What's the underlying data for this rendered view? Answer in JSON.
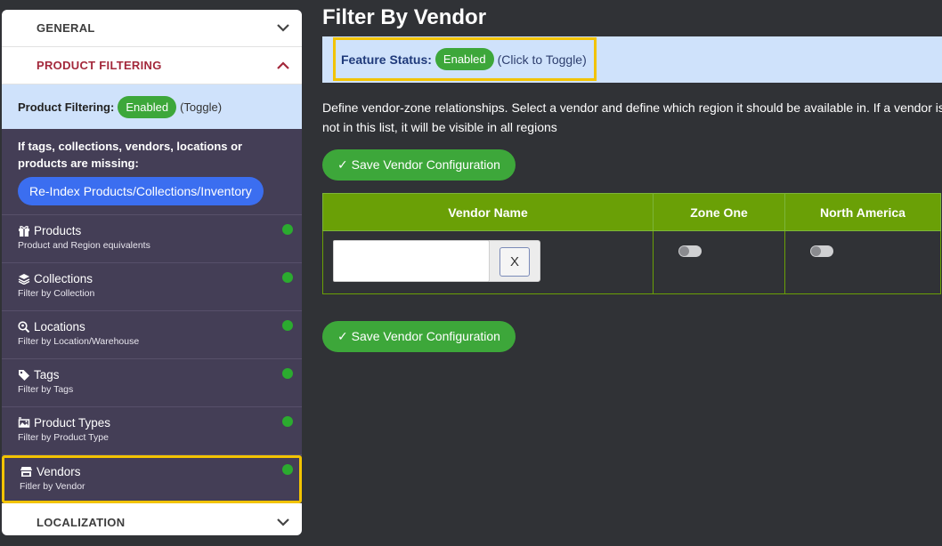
{
  "sidebar": {
    "general_label": "GENERAL",
    "product_filtering_label": "PRODUCT FILTERING",
    "pf_status_label": "Product Filtering:",
    "pf_status_badge": "Enabled",
    "pf_toggle": "(Toggle)",
    "reindex_note": "If tags, collections, vendors, locations or products are missing:",
    "reindex_button": "Re-Index Products/Collections/Inventory",
    "items": [
      {
        "title": "Products",
        "sub": "Product and Region equivalents",
        "icon": "gift-icon"
      },
      {
        "title": "Collections",
        "sub": "Filter by Collection",
        "icon": "layers-icon"
      },
      {
        "title": "Locations",
        "sub": "Filter by Location/Warehouse",
        "icon": "search-location-icon"
      },
      {
        "title": "Tags",
        "sub": "Filter by Tags",
        "icon": "tag-icon"
      },
      {
        "title": "Product Types",
        "sub": "Filter by Product Type",
        "icon": "product-type-icon"
      },
      {
        "title": "Vendors",
        "sub": "Fitler by Vendor",
        "icon": "store-icon"
      }
    ],
    "localization_label": "LOCALIZATION",
    "status_dot_color": "#2bab2f"
  },
  "main": {
    "title": "Filter By Vendor",
    "feature_status_label": "Feature Status:",
    "feature_status_badge": "Enabled",
    "feature_toggle": "(Click to Toggle)",
    "description": "Define vendor-zone relationships. Select a vendor and define which region it should be available in. If a vendor is not in this list, it will be visible in all regions",
    "save_button": "✓ Save Vendor Configuration",
    "table": {
      "headers": [
        "Vendor Name",
        "Zone One",
        "North America"
      ],
      "clear_button": "X",
      "vendor_value": ""
    }
  },
  "colors": {
    "accent_green": "#3da73a",
    "table_header": "#6aa006",
    "highlight": "#f2c300",
    "sidebar_bg": "#443e56",
    "active_section": "#a3283b"
  }
}
